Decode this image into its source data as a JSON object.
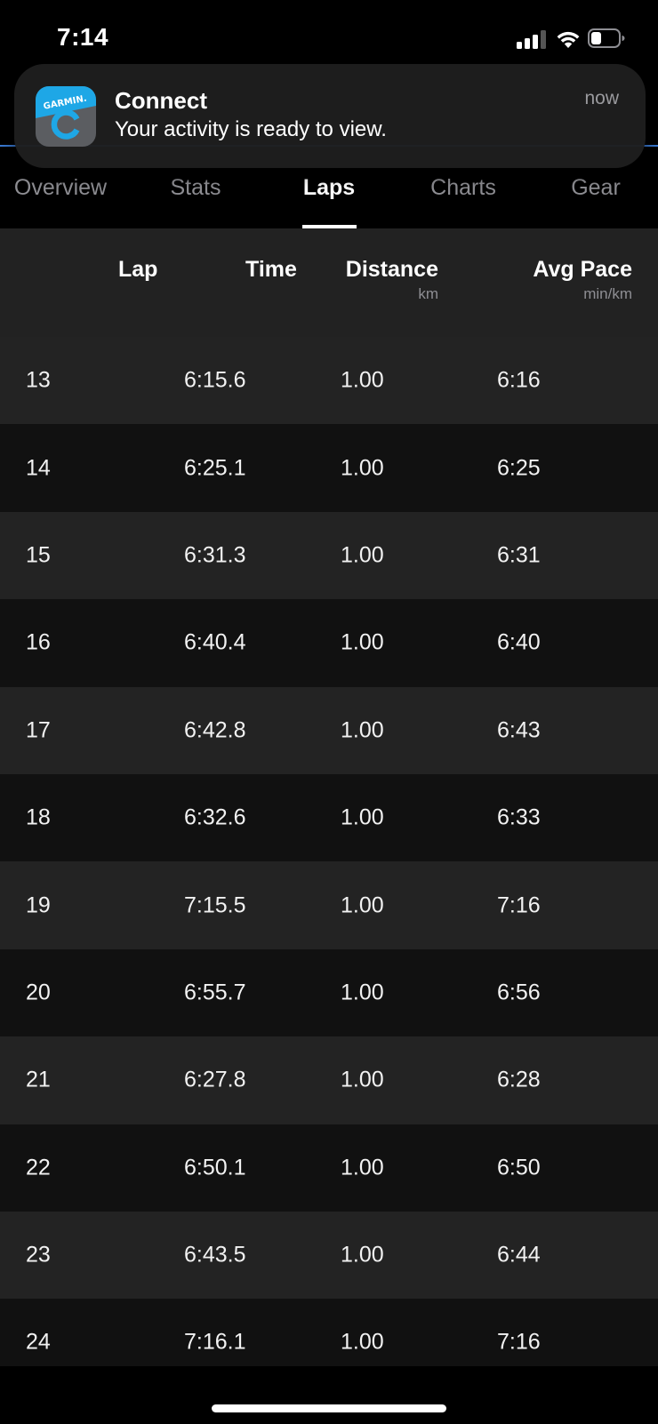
{
  "status_bar": {
    "time": "7:14"
  },
  "notification": {
    "app_name": "Connect",
    "message": "Your activity is ready to view.",
    "time": "now",
    "icon_text": "GARMIN."
  },
  "tabs": [
    {
      "label": "Overview",
      "active": false
    },
    {
      "label": "Stats",
      "active": false
    },
    {
      "label": "Laps",
      "active": true
    },
    {
      "label": "Charts",
      "active": false
    },
    {
      "label": "Gear",
      "active": false
    }
  ],
  "table": {
    "columns": {
      "lap": "Lap",
      "time": "Time",
      "distance": "Distance",
      "distance_unit": "km",
      "avg_pace": "Avg Pace",
      "avg_pace_unit": "min/km"
    },
    "rows": [
      {
        "lap": "13",
        "time": "6:15.6",
        "distance": "1.00",
        "pace": "6:16"
      },
      {
        "lap": "14",
        "time": "6:25.1",
        "distance": "1.00",
        "pace": "6:25"
      },
      {
        "lap": "15",
        "time": "6:31.3",
        "distance": "1.00",
        "pace": "6:31"
      },
      {
        "lap": "16",
        "time": "6:40.4",
        "distance": "1.00",
        "pace": "6:40"
      },
      {
        "lap": "17",
        "time": "6:42.8",
        "distance": "1.00",
        "pace": "6:43"
      },
      {
        "lap": "18",
        "time": "6:32.6",
        "distance": "1.00",
        "pace": "6:33"
      },
      {
        "lap": "19",
        "time": "7:15.5",
        "distance": "1.00",
        "pace": "7:16"
      },
      {
        "lap": "20",
        "time": "6:55.7",
        "distance": "1.00",
        "pace": "6:56"
      },
      {
        "lap": "21",
        "time": "6:27.8",
        "distance": "1.00",
        "pace": "6:28"
      },
      {
        "lap": "22",
        "time": "6:50.1",
        "distance": "1.00",
        "pace": "6:50"
      },
      {
        "lap": "23",
        "time": "6:43.5",
        "distance": "1.00",
        "pace": "6:44"
      },
      {
        "lap": "24",
        "time": "7:16.1",
        "distance": "1.00",
        "pace": "7:16"
      }
    ]
  },
  "colors": {
    "background": "#000000",
    "row_light": "#232323",
    "row_dark": "#111111",
    "accent_line": "#3a7bd5",
    "garmin_blue": "#1ea7e6"
  }
}
